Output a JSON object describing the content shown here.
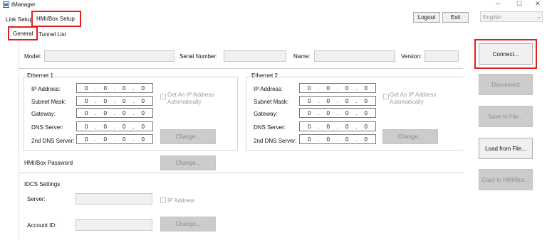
{
  "window": {
    "title": "tManager",
    "minimize": "─",
    "maximize": "☐",
    "close": "✕"
  },
  "top_tabs": {
    "link_setup": "Link Setup",
    "hmi_box_setup": "HMI/Box Setup"
  },
  "sub_tabs": {
    "general": "General",
    "tunnel_list": "Tunnel List"
  },
  "top_buttons": {
    "logout": "Logout",
    "exit": "Exit"
  },
  "language": {
    "value": "English",
    "arrow": "⌄"
  },
  "model_row": {
    "model": "Model:",
    "serial": "Serial Number:",
    "name": "Name:",
    "version": "Version:"
  },
  "ethernet1": {
    "title": "Ethernet 1",
    "fields": [
      {
        "label": "IP Address:",
        "octets": [
          "0",
          "0",
          "0",
          "0"
        ]
      },
      {
        "label": "Subnet Mask:",
        "octets": [
          "0",
          "0",
          "0",
          "0"
        ]
      },
      {
        "label": "Gateway:",
        "octets": [
          "0",
          "0",
          "0",
          "0"
        ]
      },
      {
        "label": "DNS Server:",
        "octets": [
          "0",
          "0",
          "0",
          "0"
        ]
      },
      {
        "label": "2nd DNS Server:",
        "octets": [
          "0",
          "0",
          "0",
          "0"
        ]
      }
    ],
    "auto_label_1": "Get An IP Address",
    "auto_label_2": "Automatically",
    "change": "Change..."
  },
  "ethernet2": {
    "title": "Ethernet 2",
    "fields": [
      {
        "label": "IP Address:",
        "octets": [
          "0",
          "0",
          "0",
          "0"
        ]
      },
      {
        "label": "Subnet Mask:",
        "octets": [
          "0",
          "0",
          "0",
          "0"
        ]
      },
      {
        "label": "Gateway:",
        "octets": [
          "0",
          "0",
          "0",
          "0"
        ]
      },
      {
        "label": "DNS Server:",
        "octets": [
          "0",
          "0",
          "0",
          "0"
        ]
      },
      {
        "label": "2nd DNS Server:",
        "octets": [
          "0",
          "0",
          "0",
          "0"
        ]
      }
    ],
    "auto_label_1": "Get An IP Address",
    "auto_label_2": "Automatically",
    "change": "Change..."
  },
  "password": {
    "label": "HMI/Box Password",
    "change": "Change..."
  },
  "idcs": {
    "title": "IDCS Settings",
    "server": "Server:",
    "ip_address": "IP Address",
    "account": "Account ID:",
    "change": "Change..."
  },
  "side_buttons": {
    "connect": "Connect...",
    "disconnect": "Disconnect",
    "save": "Save to File...",
    "load": "Load from File...",
    "copy": "Copy to HMI/Box..."
  }
}
